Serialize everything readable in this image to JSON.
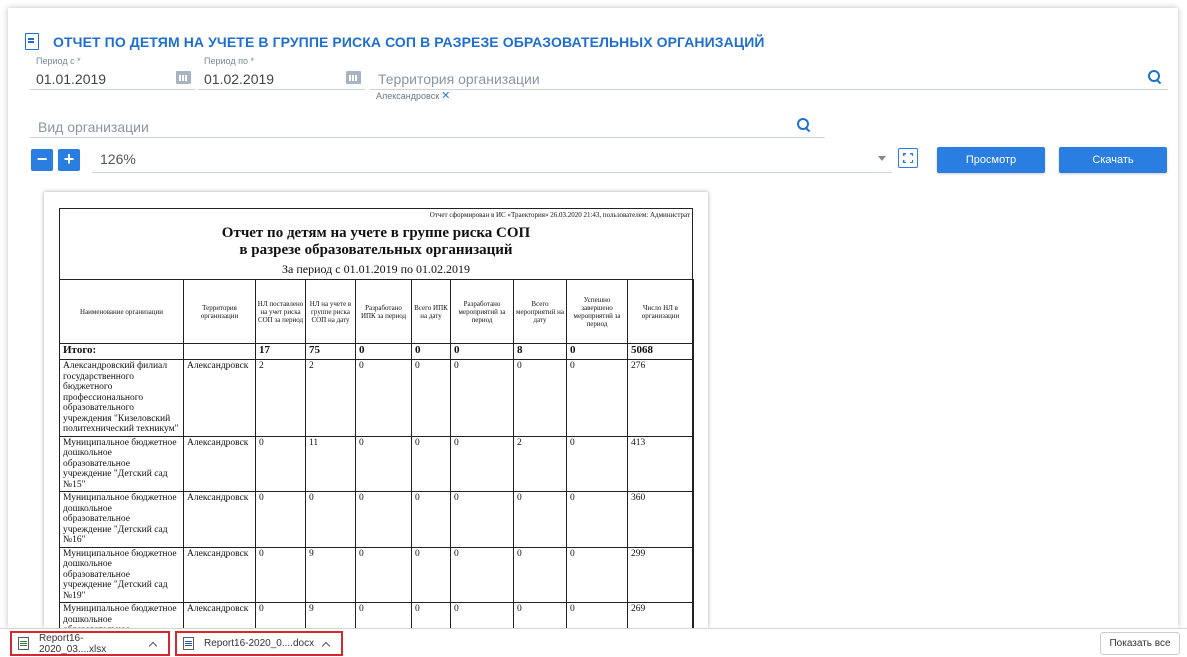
{
  "header": {
    "title": "ОТЧЕТ ПО ДЕТЯМ НА УЧЕТЕ В ГРУППЕ РИСКА СОП В РАЗРЕЗЕ ОБРАЗОВАТЕЛЬНЫХ ОРГАНИЗАЦИЙ"
  },
  "filters": {
    "period_from": {
      "label": "Период с *",
      "value": "01.01.2019"
    },
    "period_to": {
      "label": "Период по *",
      "value": "01.02.2019"
    },
    "territory": {
      "placeholder": "Территория организации",
      "chip": "Александровск"
    },
    "org_type": {
      "placeholder": "Вид организации"
    }
  },
  "toolbar": {
    "zoom_out": "−",
    "zoom_in": "+",
    "zoom_value": "126%",
    "preview_label": "Просмотр",
    "download_label": "Скачать"
  },
  "report": {
    "meta": "Отчет сформирован в ИС «Траектория» 26.03.2020 21:43, пользователем: Администрат",
    "title_line1": "Отчет по детям на учете в группе риска СОП",
    "title_line2": "в разрезе образовательных организаций",
    "period": "За период с 01.01.2019 по 01.02.2019",
    "columns": [
      "Наименование организации",
      "Территория организации",
      "НЛ поставлено на учет риска СОП за период",
      "НЛ на учете в группе риска СОП на дату",
      "Разработано ИПК за период",
      "Всего ИПК на дату",
      "Разработано мероприятий за период",
      "Всего мероприятий на дату",
      "Успешно завершено мероприятий за период",
      "Число НЛ в организации"
    ],
    "total": [
      "Итого:",
      "",
      "17",
      "75",
      "0",
      "0",
      "0",
      "8",
      "0",
      "5068"
    ],
    "rows": [
      [
        "Александровский филиал государственного бюджетного профессионального образовательного учреждения \"Кизеловский политехнический техникум\"",
        "Александровск",
        "2",
        "2",
        "0",
        "0",
        "0",
        "0",
        "0",
        "276"
      ],
      [
        "Муниципальное бюджетное дошкольное образовательное учреждение \"Детский сад №15\"",
        "Александровск",
        "0",
        "11",
        "0",
        "0",
        "0",
        "2",
        "0",
        "413"
      ],
      [
        "Муниципальное бюджетное дошкольное образовательное учреждение \"Детский сад №16\"",
        "Александровск",
        "0",
        "0",
        "0",
        "0",
        "0",
        "0",
        "0",
        "360"
      ],
      [
        "Муниципальное бюджетное дошкольное образовательное учреждение \"Детский сад №19\"",
        "Александровск",
        "0",
        "9",
        "0",
        "0",
        "0",
        "0",
        "0",
        "299"
      ],
      [
        "Муниципальное бюджетное дошкольное образовательное учреждение \"Детский сад",
        "Александровск",
        "0",
        "9",
        "0",
        "0",
        "0",
        "0",
        "0",
        "269"
      ]
    ]
  },
  "downloads": {
    "items": [
      {
        "name": "Report16-2020_03....xlsx",
        "type": "excel"
      },
      {
        "name": "Report16-2020_0....docx",
        "type": "word"
      }
    ],
    "show_all": "Показать все"
  },
  "colors": {
    "accent": "#2a7de1",
    "title": "#1f6fd1",
    "highlight": "#d7262d"
  }
}
